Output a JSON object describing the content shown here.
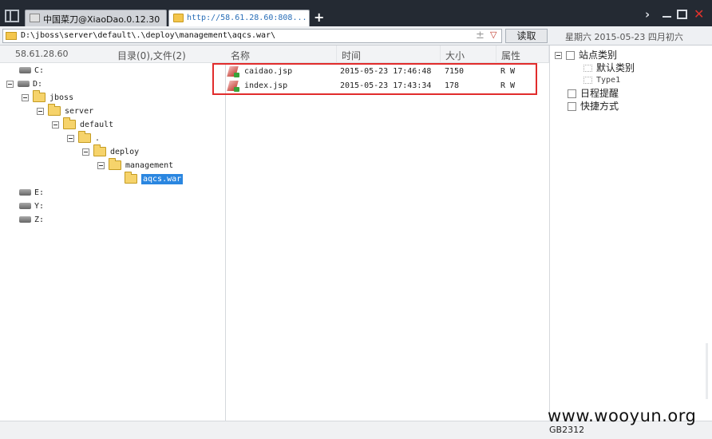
{
  "tabs": [
    {
      "label": "中国菜刀@XiaoDao.0.12.30"
    },
    {
      "label": "http://58.61.28.60:808..."
    }
  ],
  "new_tab_symbol": "+",
  "window_buttons": {
    "chevron": "›",
    "close": "✕"
  },
  "address": {
    "path": "D:\\jboss\\server\\default\\.\\deploy\\management\\aqcs.war\\",
    "sym": "±",
    "dropdown": "▽",
    "read_label": "读取",
    "date": "星期六 2015-05-23 四月初六"
  },
  "left": {
    "host": "58.61.28.60",
    "count_label": "目录(0),文件(2)",
    "drives_top": [
      "C:",
      "D:"
    ],
    "tree": [
      {
        "label": "jboss"
      },
      {
        "label": "server"
      },
      {
        "label": "default"
      },
      {
        "label": "."
      },
      {
        "label": "deploy"
      },
      {
        "label": "management"
      },
      {
        "label": "aqcs.war",
        "selected": true
      }
    ],
    "drives_bottom": [
      "E:",
      "Y:",
      "Z:"
    ]
  },
  "columns": {
    "name": "名称",
    "time": "时间",
    "size": "大小",
    "attr": "属性"
  },
  "files": [
    {
      "name": "caidao.jsp",
      "time": "2015-05-23 17:46:48",
      "size": "7150",
      "attr": "R W"
    },
    {
      "name": "index.jsp",
      "time": "2015-05-23 17:43:34",
      "size": "178",
      "attr": "R W"
    }
  ],
  "right": {
    "site_category": "站点类别",
    "default_category": "默认类别",
    "type1": "Type1",
    "reminder": "日程提醒",
    "shortcut": "快捷方式"
  },
  "status": {
    "encoding": "GB2312"
  },
  "watermark": "www.wooyun.org",
  "icons": [
    "app-icon",
    "folder-icon",
    "drive-icon",
    "file-jsp-icon",
    "expander-icon",
    "calendar-icon",
    "hand-icon"
  ],
  "colors": {
    "highlight": "#e12c2c",
    "selection": "#2a86e0",
    "titlebar": "#242a33",
    "close": "#e0322c"
  }
}
